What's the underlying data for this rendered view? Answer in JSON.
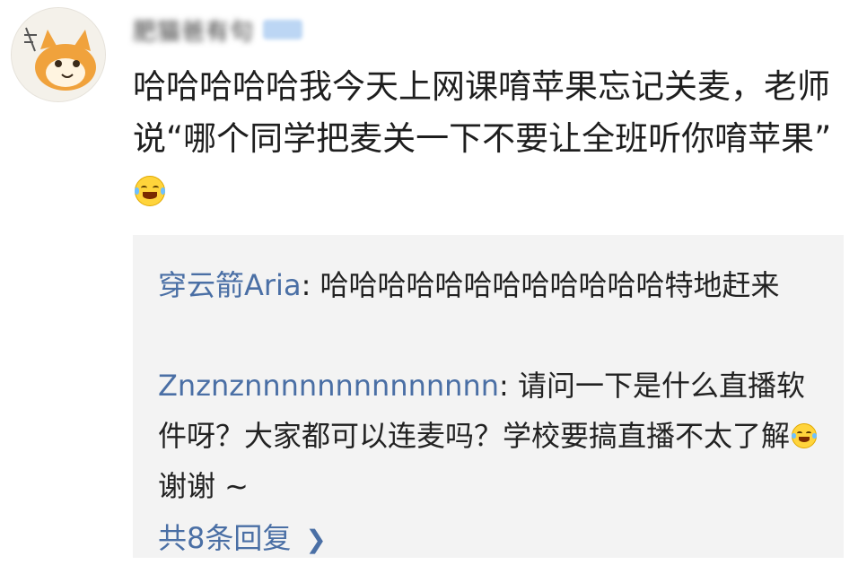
{
  "post": {
    "username": "肥猫爸有句",
    "text": "哈哈哈哈哈我今天上网课唷苹果忘记关麦，老师说“哪个同学把麦关一下不要让全班听你唷苹果”",
    "emoji_icon": "laughing-tears-emoji"
  },
  "comments": [
    {
      "user": "穿云箭Aria",
      "separator": ": ",
      "text": "哈哈哈哈哈哈哈哈哈哈哈哈特地赶来"
    },
    {
      "user": "Znznznnnnnnnnnnnnnn",
      "separator": ": ",
      "text_before_emoji": "请问一下是什么直播软件呀？大家都可以连麦吗？学校要搞直播不太了解",
      "text_after_emoji": "谢谢 ~",
      "emoji_icon": "laughing-tears-emoji"
    }
  ],
  "more_replies": {
    "label": "共8条回复",
    "icon": "chevron-right-icon"
  }
}
